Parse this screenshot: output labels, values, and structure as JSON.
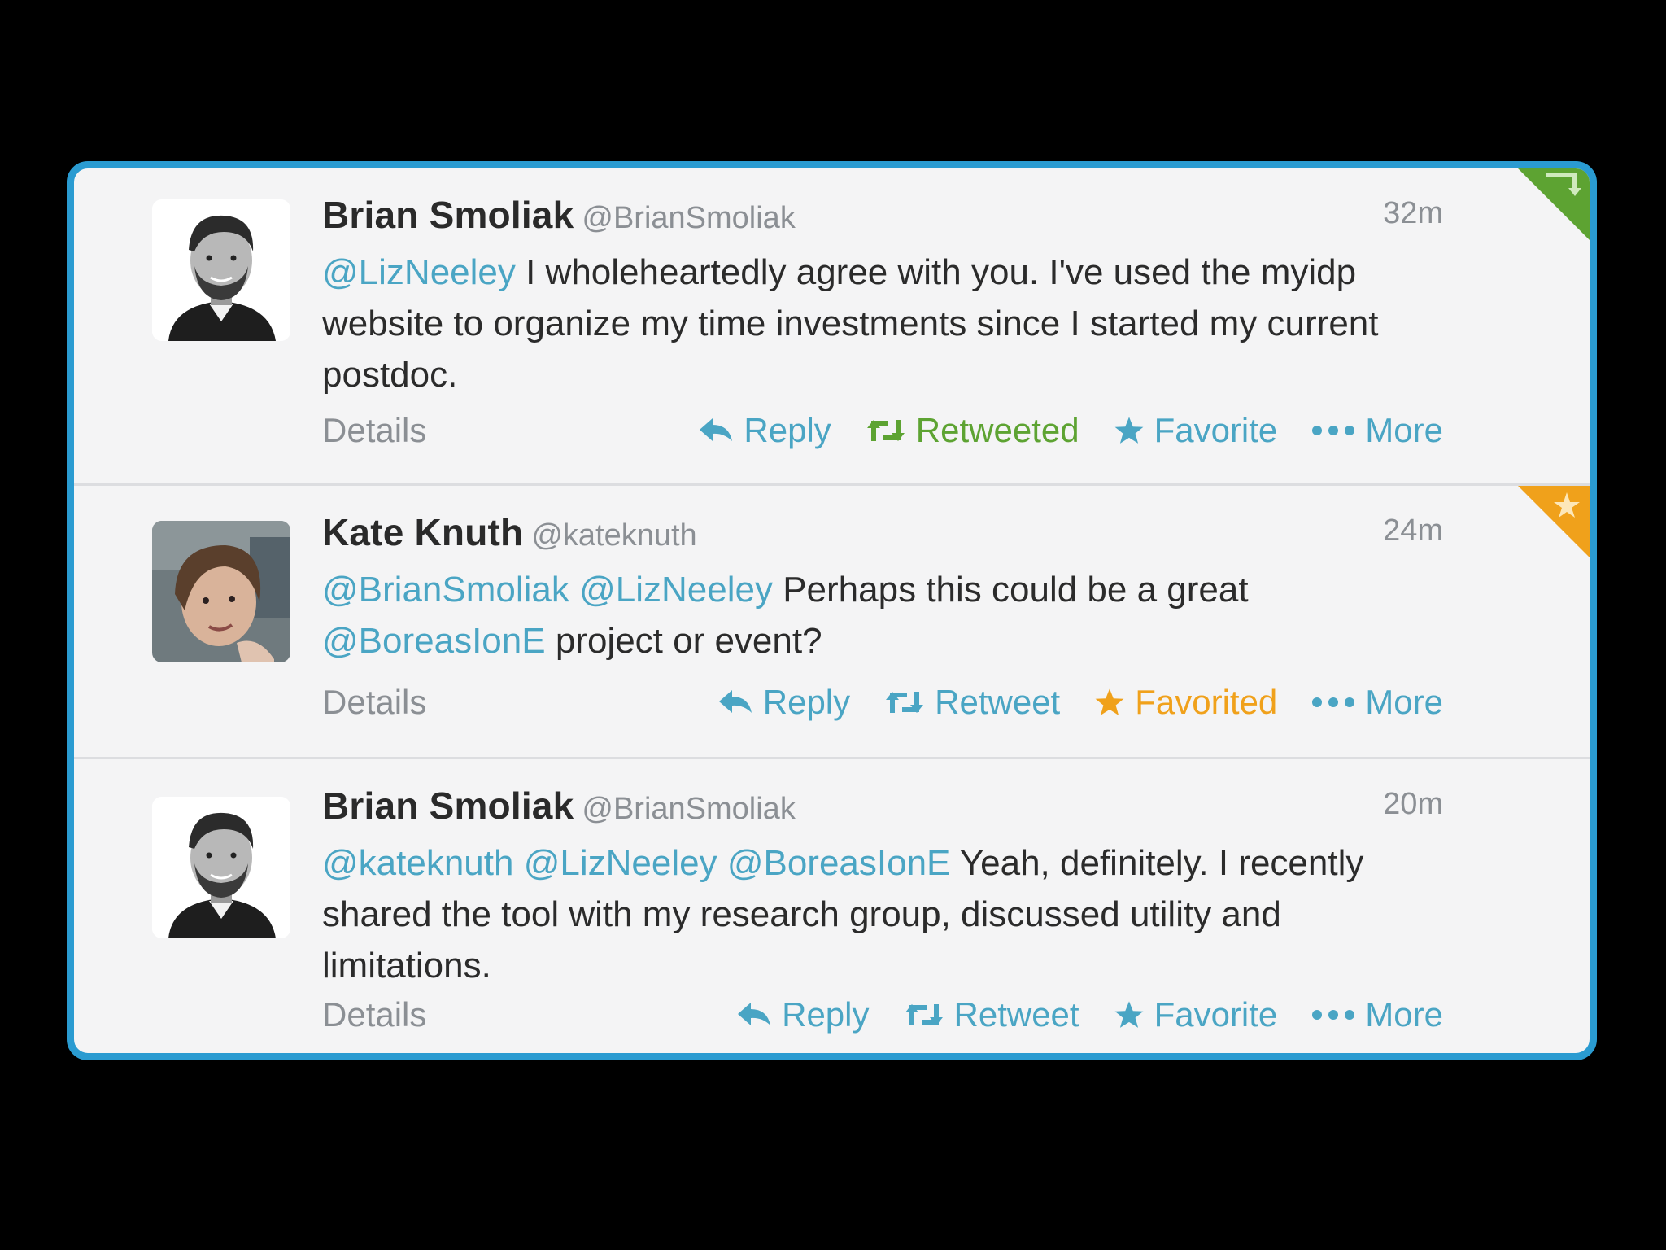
{
  "colors": {
    "frame": "#2a9bd1",
    "mention": "#4aa5c4",
    "retweeted": "#5da332",
    "favorited": "#f0a11b",
    "muted": "#8b8f94"
  },
  "tweets": [
    {
      "name": "Brian Smoliak",
      "handle": "@BrianSmoliak",
      "time": "32m",
      "segments": [
        {
          "mention": "@LizNeeley"
        },
        {
          "text": " I wholeheartedly agree with you. I've used the myidp website to organize my time investments since I started my current postdoc."
        }
      ],
      "details": "Details",
      "reply": "Reply",
      "retweet": "Retweeted",
      "favorite": "Favorite",
      "more": "More",
      "corner": "retweeted"
    },
    {
      "name": "Kate Knuth",
      "handle": "@kateknuth",
      "time": "24m",
      "segments": [
        {
          "mention": "@BrianSmoliak"
        },
        {
          "text": " "
        },
        {
          "mention": "@LizNeeley"
        },
        {
          "text": " Perhaps this could be a great "
        },
        {
          "mention": "@BoreasIonE"
        },
        {
          "text": " project or event?"
        }
      ],
      "details": "Details",
      "reply": "Reply",
      "retweet": "Retweet",
      "favorite": "Favorited",
      "more": "More",
      "corner": "favorited"
    },
    {
      "name": "Brian Smoliak",
      "handle": "@BrianSmoliak",
      "time": "20m",
      "segments": [
        {
          "mention": "@kateknuth"
        },
        {
          "text": " "
        },
        {
          "mention": "@LizNeeley"
        },
        {
          "text": " "
        },
        {
          "mention": "@BoreasIonE"
        },
        {
          "text": " Yeah, definitely. I recently shared the tool with my research group, discussed utility and limitations."
        }
      ],
      "details": "Details",
      "reply": "Reply",
      "retweet": "Retweet",
      "favorite": "Favorite",
      "more": "More",
      "corner": ""
    }
  ]
}
